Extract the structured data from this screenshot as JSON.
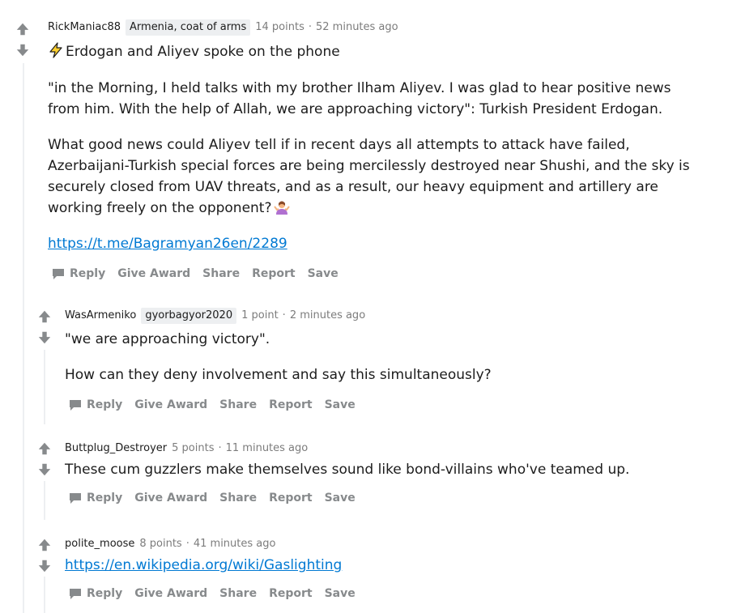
{
  "comments": [
    {
      "user": "RickManiac88",
      "flair": "Armenia, coat of arms",
      "score": "14 points",
      "time": "52 minutes ago",
      "title": "Erdogan and Aliyev spoke on the phone",
      "para1": "\"in the Morning, I held talks with my brother Ilham Aliyev. I was glad to hear positive news from him. With the help of Allah, we are approaching victory\": Turkish President Erdogan.",
      "para2": "What good news could Aliyev tell if in recent days all attempts to attack have failed, Azerbaijani-Turkish special forces are being mercilessly destroyed near Shushi, and the sky is securely closed from UAV threats, and as a result, our heavy equipment and artillery are working freely on the opponent?",
      "link": "https://t.me/Bagramyan26en/2289"
    },
    {
      "user": "WasArmeniko",
      "flair": "gyorbagyor2020",
      "score": "1 point",
      "time": "2 minutes ago",
      "para1": "\"we are approaching victory\".",
      "para2": "How can they deny involvement and say this simultaneously?"
    },
    {
      "user": "Buttplug_Destroyer",
      "score": "5 points",
      "time": "11 minutes ago",
      "para1": "These cum guzzlers make themselves sound like bond-villains who've teamed up."
    },
    {
      "user": "polite_moose",
      "score": "8 points",
      "time": "41 minutes ago",
      "link": "https://en.wikipedia.org/wiki/Gaslighting"
    }
  ],
  "actions": {
    "reply": "Reply",
    "award": "Give Award",
    "share": "Share",
    "report": "Report",
    "save": "Save"
  },
  "dot": "·",
  "icons": {
    "upvote": "arrow-up-icon",
    "downvote": "arrow-down-icon",
    "reply": "speech-bubble-icon",
    "bolt": "lightning-bolt-emoji",
    "shrug": "person-shrugging-emoji"
  },
  "colors": {
    "link": "#0079d3",
    "muted": "#878a8c",
    "flair_bg": "#edeff1",
    "thread_line": "#edeff1"
  }
}
